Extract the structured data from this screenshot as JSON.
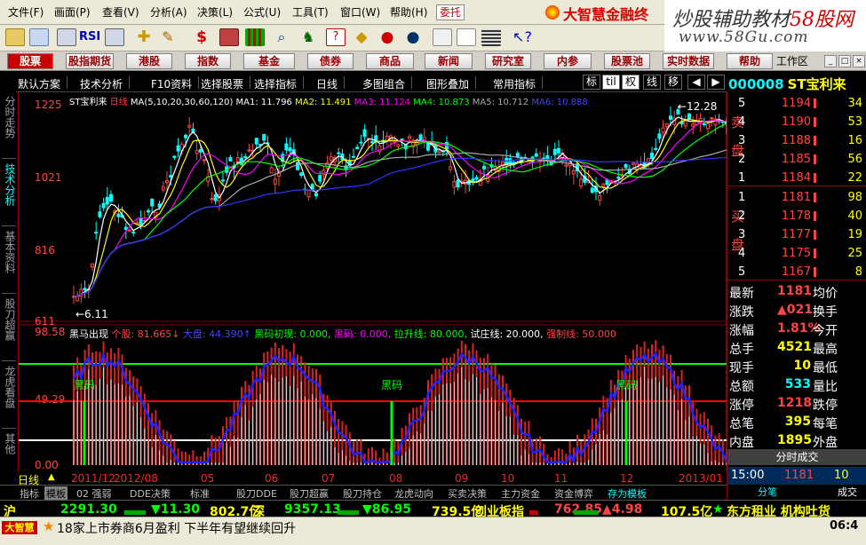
{
  "menu": {
    "items": [
      "文件(F)",
      "画面(P)",
      "查看(V)",
      "分析(A)",
      "决策(L)",
      "公式(U)",
      "工具(T)",
      "窗口(W)",
      "帮助(H)"
    ],
    "trade": "委托",
    "brand": "大智慧金融终"
  },
  "watermark": {
    "line1_a": "炒股辅助教材",
    "line1_b": "58股网",
    "line2": "www.58Gu.com"
  },
  "nav": {
    "items": [
      "股票",
      "股指期货",
      "港股",
      "指数",
      "基金",
      "债券",
      "商品",
      "新闻",
      "研究室",
      "内参",
      "股票池",
      "实时数据",
      "帮助"
    ],
    "workspace": "工作区"
  },
  "chart_toolbar": {
    "items": [
      "默认方案",
      "技术分析",
      "F10资料",
      "选择股票",
      "选择指标",
      "日线",
      "多图组合",
      "图形叠加",
      "常用指标"
    ],
    "small": [
      "标",
      "til",
      "权",
      "线",
      "移"
    ]
  },
  "stock": {
    "code": "000008",
    "name": "ST宝利来"
  },
  "left_tabs": [
    "分时走势",
    "技术分析",
    "基本资料",
    "股刀超赢",
    "龙虎看盘",
    "其他"
  ],
  "ma_legend": {
    "name": "ST宝利来",
    "period": "日线",
    "params": "MA(5,10,20,30,60,120)",
    "ma1": "MA1: 11.796",
    "ma2": "MA2: 11.491",
    "ma3": "MA3: 11.124",
    "ma4": "MA4: 10.873",
    "ma5": "MA5: 10.712",
    "ma6": "MA6: 10.888",
    "high_mark": "12.28"
  },
  "price_axis": [
    "1225",
    "1021",
    "816",
    "611"
  ],
  "low_mark": "6.11",
  "indicator": {
    "title": "黑马出现",
    "v1": "个股: 81.665↓",
    "v2": "大盘: 44.390↑",
    "v3": "黑码初现: 0.000,",
    "v4": "黑码: 0.000,",
    "v5": "拉升线: 80.000,",
    "v6": "试庄线: 20.000,",
    "v7": "强制线: 50.000",
    "axis": [
      "98.58",
      "49.29",
      "0.00"
    ],
    "signal": "黑码"
  },
  "dates": [
    "2011/12",
    "2012/08",
    "05",
    "06",
    "07",
    "08",
    "09",
    "10",
    "11",
    "12",
    "2013/01"
  ],
  "period_label": "日线",
  "bottom_tabs": [
    "指标",
    "模板",
    "02 强弱",
    "DDE决策",
    "标准",
    "股刀DDE",
    "股刀超赢",
    "股刀持仓",
    "龙虎动向",
    "买卖决策",
    "主力资金",
    "资金博弈",
    "存为模板"
  ],
  "orderbook": {
    "sell_label": "卖盘",
    "buy_label": "买盘",
    "sell": [
      {
        "idx": "5",
        "price": "1194",
        "vol": "34"
      },
      {
        "idx": "4",
        "price": "1190",
        "vol": "53"
      },
      {
        "idx": "3",
        "price": "1188",
        "vol": "16"
      },
      {
        "idx": "2",
        "price": "1185",
        "vol": "56"
      },
      {
        "idx": "1",
        "price": "1184",
        "vol": "22"
      }
    ],
    "buy": [
      {
        "idx": "1",
        "price": "1181",
        "vol": "98"
      },
      {
        "idx": "2",
        "price": "1178",
        "vol": "40"
      },
      {
        "idx": "3",
        "price": "1177",
        "vol": "19"
      },
      {
        "idx": "4",
        "price": "1175",
        "vol": "25"
      },
      {
        "idx": "5",
        "price": "1167",
        "vol": "8"
      }
    ]
  },
  "quotes": [
    {
      "l1": "最新",
      "v": "1181",
      "c": "#ff4444",
      "l2": "均价"
    },
    {
      "l1": "涨跌",
      "v": "▲021",
      "c": "#ff4444",
      "l2": "换手"
    },
    {
      "l1": "涨幅",
      "v": "1.81%",
      "c": "#ff4444",
      "l2": "今开"
    },
    {
      "l1": "总手",
      "v": "4521",
      "c": "#ffff00",
      "l2": "最高"
    },
    {
      "l1": "现手",
      "v": "10",
      "c": "#ffff00",
      "l2": "最低"
    },
    {
      "l1": "总额",
      "v": "533",
      "c": "#00ffff",
      "l2": "量比"
    },
    {
      "l1": "涨停",
      "v": "1218",
      "c": "#ff4444",
      "l2": "跌停"
    },
    {
      "l1": "总笔",
      "v": "395",
      "c": "#ffff00",
      "l2": "每笔"
    },
    {
      "l1": "内盘",
      "v": "1895",
      "c": "#ffff00",
      "l2": "外盘"
    }
  ],
  "timesales": {
    "header": "分时成交",
    "time": "15:00",
    "price": "1181",
    "vol": "10",
    "tabs": [
      "分笔",
      "成交"
    ]
  },
  "statusbar": {
    "sh_label": "沪",
    "sh_val": "2291.30",
    "sh_chg": "▼11.30",
    "sh_amt": "802.7亿",
    "sz_label": "深",
    "sz_val": "9357.13",
    "sz_chg": "▼86.95",
    "sz_amt": "739.5亿",
    "cy_label": "创业板指",
    "cy_val": "762.85",
    "cy_chg": "▲4.98",
    "cy_amt": "107.5亿",
    "news": "东方租业 机构吐货"
  },
  "ticker": {
    "logo": "大智慧",
    "text": "18家上市券商6月盈利  下半年有望继续回升",
    "time": "06:4"
  }
}
